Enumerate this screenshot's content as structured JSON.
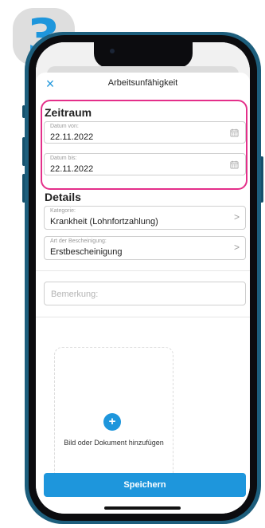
{
  "step": {
    "number": "3"
  },
  "nav": {
    "close_icon": "×",
    "title": "Arbeitsunfähigkeit"
  },
  "zeitraum": {
    "title": "Zeitraum",
    "date_from": {
      "label": "Datum von:",
      "value": "22.11.2022"
    },
    "date_to": {
      "label": "Datum bis:",
      "value": "22.11.2022"
    }
  },
  "details": {
    "title": "Details",
    "category": {
      "label": "Kategorie:",
      "value": "Krankheit (Lohnfortzahlung)"
    },
    "certificate_type": {
      "label": "Art der Bescheinigung:",
      "value": "Erstbescheinigung"
    }
  },
  "remark": {
    "placeholder": "Bemerkung:"
  },
  "upload": {
    "label": "Bild oder Dokument hinzufügen",
    "plus": "+"
  },
  "actions": {
    "save_label": "Speichern"
  },
  "colors": {
    "accent": "#1e96dc",
    "highlight": "#e42f8a",
    "phone_frame": "#1d5e7c",
    "badge": "#dedede"
  }
}
